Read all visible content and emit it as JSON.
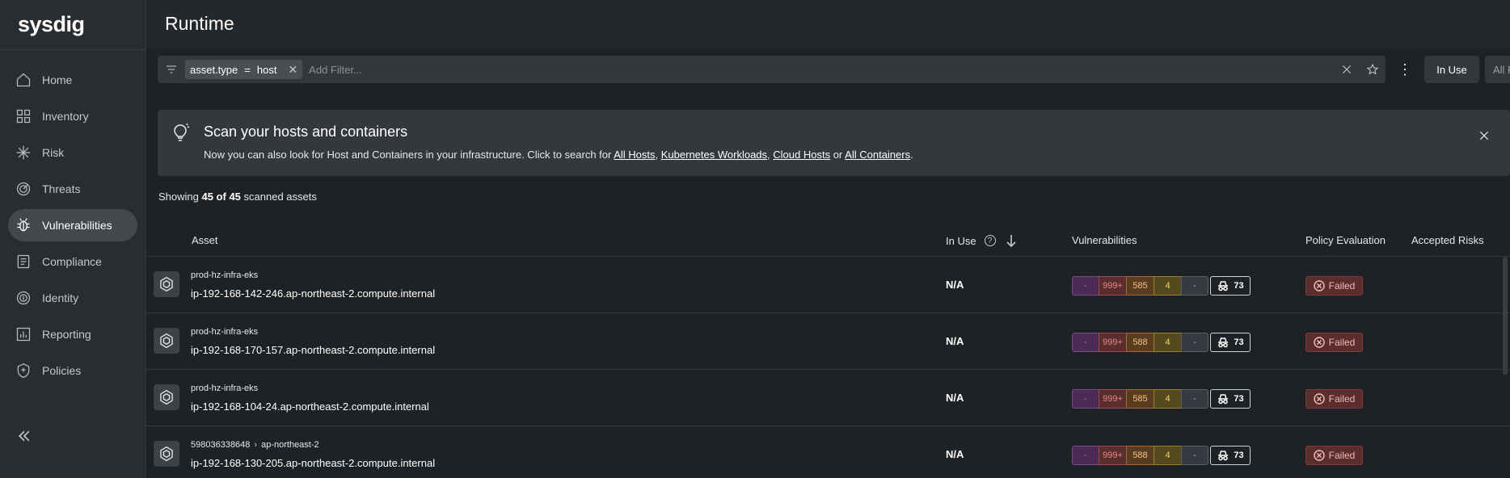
{
  "brand": {
    "logo_text": "sysdig"
  },
  "sidebar": {
    "items": [
      {
        "label": "Home",
        "icon": "home-icon"
      },
      {
        "label": "Inventory",
        "icon": "inventory-icon"
      },
      {
        "label": "Risk",
        "icon": "risk-icon"
      },
      {
        "label": "Threats",
        "icon": "threats-icon"
      },
      {
        "label": "Vulnerabilities",
        "icon": "vulnerabilities-icon",
        "active": true
      },
      {
        "label": "Compliance",
        "icon": "compliance-icon"
      },
      {
        "label": "Identity",
        "icon": "identity-icon"
      },
      {
        "label": "Reporting",
        "icon": "reporting-icon"
      },
      {
        "label": "Policies",
        "icon": "policies-icon"
      }
    ],
    "collapse_icon": "double-chevron-left-icon"
  },
  "header": {
    "title": "Runtime"
  },
  "filter": {
    "chip_key": "asset.type",
    "chip_op": "=",
    "chip_value": "host",
    "placeholder": "Add Filter...",
    "in_use_label": "In Use",
    "policy_select_value": "All Policy Evaluati..."
  },
  "banner": {
    "title": "Scan your hosts and containers",
    "text_prefix": "Now you can also look for Host and Containers in your infrastructure. Click to search for ",
    "link_all_hosts": "All Hosts",
    "sep1": ", ",
    "link_k8s": "Kubernetes Workloads",
    "sep2": ", ",
    "link_cloud": "Cloud Hosts",
    "sep3": " or ",
    "link_containers": "All Containers",
    "suffix": "."
  },
  "summary": {
    "prefix": "Showing ",
    "count": "45 of 45",
    "suffix": " scanned assets"
  },
  "table": {
    "columns": {
      "asset": "Asset",
      "in_use": "In Use",
      "vulnerabilities": "Vulnerabilities",
      "policy": "Policy Evaluation",
      "accepted": "Accepted Risks"
    },
    "rows": [
      {
        "parent": "prod-hz-infra-eks",
        "parent_region": "",
        "name": "ip-192-168-142-246.ap-northeast-2.compute.internal",
        "in_use": "N/A",
        "critical": "-",
        "high": "999+",
        "medium": "585",
        "low": "4",
        "negligible": "-",
        "exploits": "73",
        "policy": "Failed"
      },
      {
        "parent": "prod-hz-infra-eks",
        "parent_region": "",
        "name": "ip-192-168-170-157.ap-northeast-2.compute.internal",
        "in_use": "N/A",
        "critical": "-",
        "high": "999+",
        "medium": "588",
        "low": "4",
        "negligible": "-",
        "exploits": "73",
        "policy": "Failed"
      },
      {
        "parent": "prod-hz-infra-eks",
        "parent_region": "",
        "name": "ip-192-168-104-24.ap-northeast-2.compute.internal",
        "in_use": "N/A",
        "critical": "-",
        "high": "999+",
        "medium": "585",
        "low": "4",
        "negligible": "-",
        "exploits": "73",
        "policy": "Failed"
      },
      {
        "parent": "598036338648",
        "parent_region": "ap-northeast-2",
        "name": "ip-192-168-130-205.ap-northeast-2.compute.internal",
        "in_use": "N/A",
        "critical": "-",
        "high": "999+",
        "medium": "588",
        "low": "4",
        "negligible": "-",
        "exploits": "73",
        "policy": "Failed"
      }
    ]
  },
  "colors": {
    "critical": "#4a2b55",
    "high": "#5a2e2e",
    "medium": "#5a3d20",
    "low": "#554a1f",
    "negligible": "#353a40",
    "failed": "#5a2e2d"
  }
}
